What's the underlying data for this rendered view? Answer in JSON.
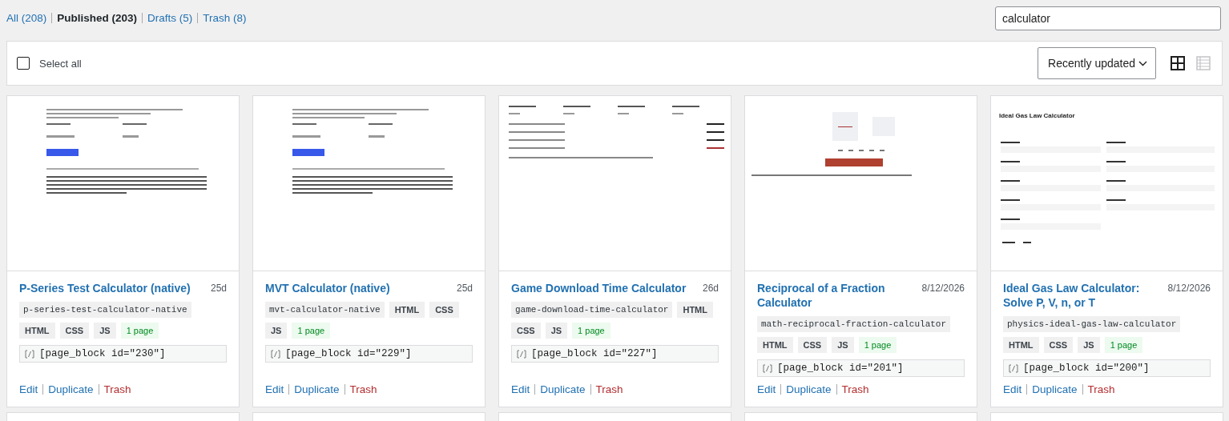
{
  "filters": [
    {
      "label": "All (208)",
      "selected": false
    },
    {
      "label": "Published (203)",
      "selected": true
    },
    {
      "label": "Drafts (5)",
      "selected": false
    },
    {
      "label": "Trash (8)",
      "selected": false
    }
  ],
  "search": {
    "value": "calculator"
  },
  "toolbar": {
    "select_all": {
      "label": "Select all",
      "checked": false
    },
    "sort": {
      "value": "Recently updated"
    },
    "views": [
      {
        "kind": "grid",
        "selected": true
      },
      {
        "kind": "list",
        "selected": false
      }
    ]
  },
  "cards": [
    {
      "title": "P-Series Test Calculator (native)",
      "date": "25d",
      "slug": "p-series-test-calculator-native",
      "tags": [
        "HTML",
        "CSS",
        "JS"
      ],
      "pages": "1 page",
      "shortcode": "[page_block id=\"230\"]",
      "actions": [
        "Edit",
        "Duplicate",
        "Trash"
      ]
    },
    {
      "title": "MVT Calculator (native)",
      "date": "25d",
      "slug": "mvt-calculator-native",
      "tags": [
        "HTML",
        "CSS",
        "JS"
      ],
      "pages": "1 page",
      "shortcode": "[page_block id=\"229\"]",
      "actions": [
        "Edit",
        "Duplicate",
        "Trash"
      ]
    },
    {
      "title": "Game Download Time Calculator",
      "date": "26d",
      "slug": "game-download-time-calculator",
      "tags": [
        "HTML",
        "CSS",
        "JS"
      ],
      "pages": "1 page",
      "shortcode": "[page_block id=\"227\"]",
      "actions": [
        "Edit",
        "Duplicate",
        "Trash"
      ]
    },
    {
      "title": "Reciprocal of a Fraction Calculator",
      "date": "8/12/2026",
      "slug": "math-reciprocal-fraction-calculator",
      "tags": [
        "HTML",
        "CSS",
        "JS"
      ],
      "pages": "1 page",
      "shortcode": "[page_block id=\"201\"]",
      "actions": [
        "Edit",
        "Duplicate",
        "Trash"
      ]
    },
    {
      "title": "Ideal Gas Law Calculator: Solve P, V, n, or T",
      "date": "8/12/2026",
      "slug": "physics-ideal-gas-law-calculator",
      "tags": [
        "HTML",
        "CSS",
        "JS"
      ],
      "pages": "1 page",
      "shortcode": "[page_block id=\"200\"]",
      "actions": [
        "Edit",
        "Duplicate",
        "Trash"
      ],
      "preview_heading": "Ideal Gas Law Calculator"
    }
  ]
}
